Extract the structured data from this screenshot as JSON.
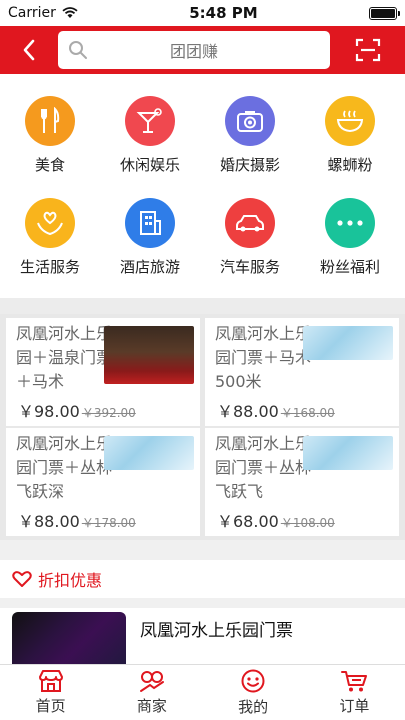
{
  "status_bar": {
    "carrier": "Carrier",
    "time": "5:48 PM",
    "battery_level": 1.0
  },
  "header": {
    "search_placeholder": "团团赚"
  },
  "categories": [
    {
      "label": "美食",
      "icon": "fork-knife-icon",
      "color": "#f59a1e"
    },
    {
      "label": "休闲娱乐",
      "icon": "cocktail-icon",
      "color": "#f0484f"
    },
    {
      "label": "婚庆摄影",
      "icon": "camera-icon",
      "color": "#6b6fe0"
    },
    {
      "label": "螺蛳粉",
      "icon": "bowl-icon",
      "color": "#f7b81c"
    },
    {
      "label": "生活服务",
      "icon": "heart-hands-icon",
      "color": "#f9b41c"
    },
    {
      "label": "酒店旅游",
      "icon": "hotel-icon",
      "color": "#2f7de8"
    },
    {
      "label": "汽车服务",
      "icon": "car-icon",
      "color": "#ee3f3f"
    },
    {
      "label": "粉丝福利",
      "icon": "more-dots-icon",
      "color": "#19c39a"
    }
  ],
  "deals": [
    {
      "title": "凤凰河水上乐园＋温泉门票＋马术",
      "price": "￥98.00",
      "old_price": "￥392.00"
    },
    {
      "title": "凤凰河水上乐园门票＋马术500米",
      "price": "￥88.00",
      "old_price": "￥168.00"
    },
    {
      "title": "凤凰河水上乐园门票＋丛林飞跃深",
      "price": "￥88.00",
      "old_price": "￥178.00"
    },
    {
      "title": "凤凰河水上乐园门票＋丛林飞跃飞",
      "price": "￥68.00",
      "old_price": "￥108.00"
    }
  ],
  "discount_section": {
    "title": "折扣优惠"
  },
  "list": [
    {
      "title": "凤凰河水上乐园门票"
    }
  ],
  "tabbar": [
    {
      "label": "首页",
      "icon": "shop-icon",
      "active": true
    },
    {
      "label": "商家",
      "icon": "merchant-icon",
      "active": false
    },
    {
      "label": "我的",
      "icon": "smiley-user-icon",
      "active": false
    },
    {
      "label": "订单",
      "icon": "cart-icon",
      "active": false
    }
  ],
  "colors": {
    "brand": "#e0171f",
    "tab_active": "#e0171f"
  }
}
